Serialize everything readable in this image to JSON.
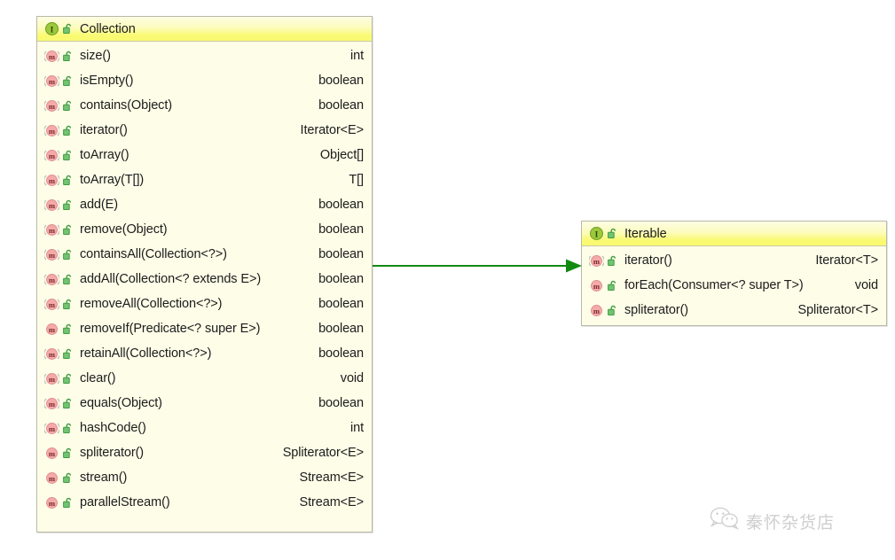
{
  "diagram": {
    "type": "uml-class-diagram",
    "background_color": "#ffffff",
    "relationship": {
      "name": "generalization",
      "from": "Collection",
      "to": "Iterable",
      "color": "#128a12",
      "style": "solid-line-filled-arrowhead"
    }
  },
  "classes": [
    {
      "id": "collection",
      "name": "Collection",
      "stereotype_icon": "interface-icon",
      "visibility_icon": "public-unlocked-icon",
      "header_color": "#fafa72",
      "body_color": "#fdfde8",
      "members": [
        {
          "icon": "abstract-method-icon",
          "lock": "public-unlocked-icon",
          "name": "size()",
          "type": "int"
        },
        {
          "icon": "abstract-method-icon",
          "lock": "public-unlocked-icon",
          "name": "isEmpty()",
          "type": "boolean"
        },
        {
          "icon": "abstract-method-icon",
          "lock": "public-unlocked-icon",
          "name": "contains(Object)",
          "type": "boolean"
        },
        {
          "icon": "abstract-method-icon",
          "lock": "public-unlocked-icon",
          "name": "iterator()",
          "type": "Iterator<E>"
        },
        {
          "icon": "abstract-method-icon",
          "lock": "public-unlocked-icon",
          "name": "toArray()",
          "type": "Object[]"
        },
        {
          "icon": "abstract-method-icon",
          "lock": "public-unlocked-icon",
          "name": "toArray(T[])",
          "type": "T[]"
        },
        {
          "icon": "abstract-method-icon",
          "lock": "public-unlocked-icon",
          "name": "add(E)",
          "type": "boolean"
        },
        {
          "icon": "abstract-method-icon",
          "lock": "public-unlocked-icon",
          "name": "remove(Object)",
          "type": "boolean"
        },
        {
          "icon": "abstract-method-icon",
          "lock": "public-unlocked-icon",
          "name": "containsAll(Collection<?>)",
          "type": "boolean"
        },
        {
          "icon": "abstract-method-icon",
          "lock": "public-unlocked-icon",
          "name": "addAll(Collection<? extends E>)",
          "type": "boolean"
        },
        {
          "icon": "abstract-method-icon",
          "lock": "public-unlocked-icon",
          "name": "removeAll(Collection<?>)",
          "type": "boolean"
        },
        {
          "icon": "default-method-icon",
          "lock": "public-unlocked-icon",
          "name": "removeIf(Predicate<? super E>)",
          "type": "boolean"
        },
        {
          "icon": "abstract-method-icon",
          "lock": "public-unlocked-icon",
          "name": "retainAll(Collection<?>)",
          "type": "boolean"
        },
        {
          "icon": "abstract-method-icon",
          "lock": "public-unlocked-icon",
          "name": "clear()",
          "type": "void"
        },
        {
          "icon": "abstract-method-icon",
          "lock": "public-unlocked-icon",
          "name": "equals(Object)",
          "type": "boolean"
        },
        {
          "icon": "abstract-method-icon",
          "lock": "public-unlocked-icon",
          "name": "hashCode()",
          "type": "int"
        },
        {
          "icon": "default-method-icon",
          "lock": "public-unlocked-icon",
          "name": "spliterator()",
          "type": "Spliterator<E>"
        },
        {
          "icon": "default-method-icon",
          "lock": "public-unlocked-icon",
          "name": "stream()",
          "type": "Stream<E>"
        },
        {
          "icon": "default-method-icon",
          "lock": "public-unlocked-icon",
          "name": "parallelStream()",
          "type": "Stream<E>"
        }
      ]
    },
    {
      "id": "iterable",
      "name": "Iterable",
      "stereotype_icon": "interface-icon",
      "visibility_icon": "public-unlocked-icon",
      "header_color": "#fafa72",
      "body_color": "#fdfde8",
      "members": [
        {
          "icon": "abstract-method-icon",
          "lock": "public-unlocked-icon",
          "name": "iterator()",
          "type": "Iterator<T>"
        },
        {
          "icon": "default-method-icon",
          "lock": "public-unlocked-icon",
          "name": "forEach(Consumer<? super T>)",
          "type": "void"
        },
        {
          "icon": "default-method-icon",
          "lock": "public-unlocked-icon",
          "name": "spliterator()",
          "type": "Spliterator<T>"
        }
      ]
    }
  ],
  "watermark": {
    "icon": "wechat-icon",
    "text": "秦怀杂货店"
  }
}
